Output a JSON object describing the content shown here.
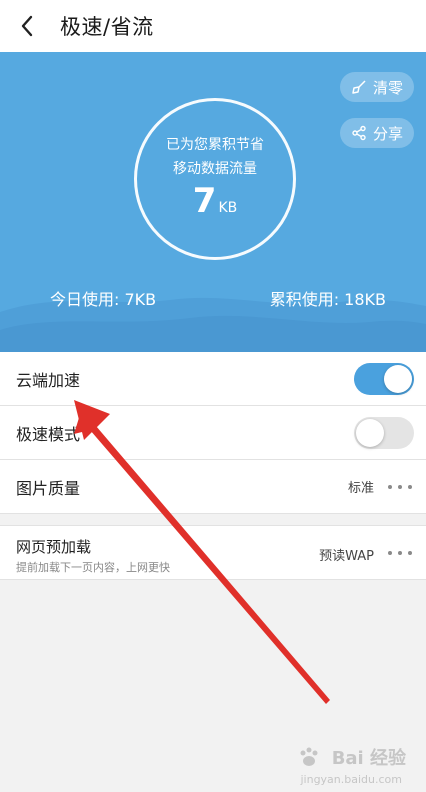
{
  "header": {
    "title": "极速/省流"
  },
  "hero": {
    "line1": "已为您累积节省",
    "line2": "移动数据流量",
    "value": "7",
    "unit": "KB",
    "clear_label": "清零",
    "share_label": "分享",
    "today_usage": "今日使用: 7KB",
    "total_usage": "累积使用: 18KB"
  },
  "settings": {
    "cloud_accel": {
      "label": "云端加速",
      "enabled": true
    },
    "speed_mode": {
      "label": "极速模式",
      "enabled": false
    },
    "image_quality": {
      "label": "图片质量",
      "value": "标准"
    },
    "web_preload": {
      "label": "网页预加载",
      "desc": "提前加载下一页内容，上网更快",
      "value": "预读WAP"
    }
  },
  "watermark": {
    "brand": "Bai 经验",
    "sub": "jingyan.baidu.com"
  },
  "colors": {
    "hero_bg": "#56a9e0",
    "toggle_on": "#4aa1de",
    "annotation_arrow": "#e0302a"
  },
  "icons": {
    "back": "chevron-left-icon",
    "clear": "broom-icon",
    "share": "share-icon",
    "more": "more-dots-icon"
  }
}
